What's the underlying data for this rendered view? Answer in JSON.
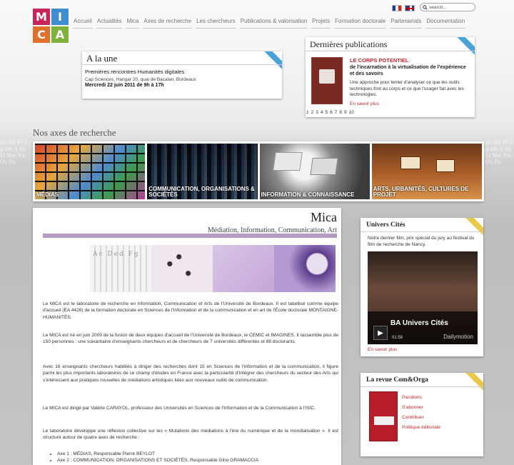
{
  "logo": {
    "letters": [
      "M",
      "I",
      "C",
      "A"
    ],
    "colors": [
      "#c6245a",
      "#3f8dd0",
      "#e0702a",
      "#7fb23a"
    ]
  },
  "nav": [
    "Accueil",
    "Actualités",
    "Mica",
    "Axes de recherche",
    "Les chercheurs",
    "Publications & valorisation",
    "Projets",
    "Formation doctorale",
    "Partenariats",
    "Documentation"
  ],
  "search": {
    "placeholder": "search..."
  },
  "une": {
    "heading": "A la une",
    "title": "Premières rencontres Humanités digitales",
    "place": "Cap Sciences, Hangar 20, quai de Bacalan, Bordeaux",
    "date": "Mercredi 22 juin 2011 de 9h à 17h"
  },
  "pubs": {
    "heading": "Dernières publications",
    "title": "LE CORPS POTENTIEL",
    "subtitle": "de l'incarnation à la virtualisation de l'expérience et des savoirs",
    "description": "Une approche pour tenter d'analyser ce que les outils techniques font au corps et ce que l'usager fait avec les technologies.",
    "link": "En savoir plus",
    "pages": [
      "1",
      "2",
      "3",
      "4",
      "5",
      "6",
      "7",
      "8",
      "9",
      "10"
    ]
  },
  "axes": {
    "heading": "Nos axes de recherche",
    "items": [
      "MÉDIAS",
      "COMMUNICATION, ORGANISATIONS & SOCIÉTÉS",
      "INFORMATION & CONNAISSANCE",
      "ARTS, URBANITÉS, CULTURES DE PROJET"
    ]
  },
  "main": {
    "title": "Mica",
    "subtitle": "Médiation, Information, Communication, Art",
    "p1": "Le MICA est le laboratoire de recherche en Information, Communication et Arts de l'Université de Bordeaux. Il est labellisé comme équipe d'accueil (EA 4426) de la formation doctorale en Sciences de l'Information et de la communication et en art de l'École doctorale MONTAIGNE-HUMANITÉS.",
    "p2": "Le MICA est né en juin 2009 de la fusion de deux équipes d'accueil de l'Université de Bordeaux, le CEMIC et IMAGINES. Il rassemble plus de 150 personnes : une soixantaine d'enseignants chercheurs et de chercheurs de 7 universités différentes et 88 doctorants.",
    "p3": "Avec 16 enseignants chercheurs habilités à diriger des recherches dont 15 en Sciences de l'information et de la communication, il figure parmi les plus importants laboratoires de ce champ d'études en France avec la particularité d'intégrer des chercheurs du secteur des Arts qui s'intéressent aux pratiques nouvelles de médiations artistiques liées aux nouveaux outils de communication.",
    "p4": "Le MICA est dirigé par Valérie CARAYOL, professeur des Universités en Sciences de l'Information et de la Communication à l'ISIC.",
    "p5": "Le laboratoire développe une réflexion collective sur les « Mutations des médiations à l'ère du numérique et de la mondialisation ». Il est structuré autour de quatre axes de recherche :",
    "list": [
      "Axe 1 : MÉDIAS, Responsable Pierre BEYLOT",
      "Axe 2 : COMMUNICATION, ORGANISATIONS ET SOCIÉTÉS, Responsable Gino GRAMACCIA"
    ]
  },
  "univ": {
    "heading": "Univers Cités",
    "description": "Notre dernier film, prix spécial du jury au festival du film de recherche de Nancy.",
    "video_title": "BA Univers Cités",
    "video_time": "01:58",
    "video_brand": "Dailymotion",
    "link": "En savoir plus"
  },
  "revue": {
    "heading": "La revue Com&Orga",
    "links": [
      "Parutions",
      "S'abonner",
      "Contribuer",
      "Politique éditoriale"
    ]
  }
}
